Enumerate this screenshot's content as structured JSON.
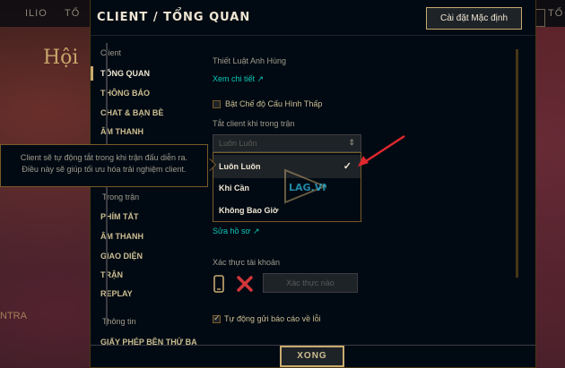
{
  "background": {
    "topbar_items": [
      "ILIO",
      "TỔ",
      "TỔ"
    ],
    "hoi_text": "Hội",
    "ntra_text": "NTRA"
  },
  "header": {
    "title": "CLIENT / TỔNG QUAN",
    "default_button": "Cài đặt Mặc định"
  },
  "sidebar": {
    "group_client": "Client",
    "items_client": [
      "TỔNG QUAN",
      "THÔNG BÁO",
      "CHAT & BẠN BÈ",
      "ÂM THANH"
    ],
    "group_ingame": "Trong trận",
    "items_ingame": [
      "PHÍM TẮT",
      "ÂM THANH",
      "GIAO DIỆN",
      "TRẬN",
      "REPLAY"
    ],
    "group_info": "Thông tin",
    "items_info": [
      "GIẤY PHÉP BÊN THỨ BA"
    ],
    "active_item": "TỔNG QUAN"
  },
  "content": {
    "champ_rules_label": "Thiết Luật Anh Hùng",
    "view_details_link": "Xem chi tiết ↗",
    "low_spec_label": "Bật Chế độ Cấu Hình Thấp",
    "low_spec_checked": false,
    "close_client_label": "Tắt client khi trong trận",
    "select_value": "Luôn Luôn",
    "dropdown_options": [
      "Luôn Luôn",
      "Khi Cần",
      "Không Bao Giờ"
    ],
    "dropdown_selected": "Luôn Luôn",
    "edit_profile_link": "Sửa hồ sơ ↗",
    "account_verify_label": "Xác thực tài khoản",
    "verify_button": "Xác thực nào",
    "auto_report_label": "Tự động gửi báo cáo về lỗi",
    "auto_report_checked": true
  },
  "tooltip": {
    "line1": "Client sẽ tự động tắt trong khi trận đấu diễn ra.",
    "line2": "Điều này sẽ giúp tối ưu hóa trải nghiệm client."
  },
  "watermark": "LAG.VN",
  "footer": {
    "done_button": "XONG"
  },
  "colors": {
    "gold": "#c8aa6e",
    "teal_link": "#0ac8b9",
    "annotation_red": "#e0282e"
  }
}
